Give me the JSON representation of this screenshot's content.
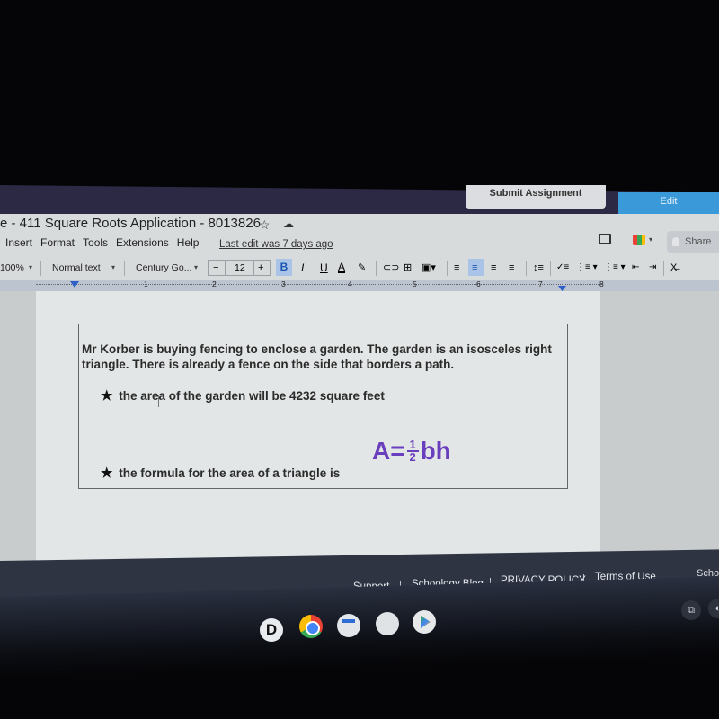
{
  "schoology": {
    "submit_label": "Submit Assignment",
    "edit_label": "Edit"
  },
  "doc": {
    "title": "e - 411 Square Roots Application - 8013826",
    "star_icon": "☆",
    "cloud_icon": "☁",
    "menu": [
      "Insert",
      "Format",
      "Tools",
      "Extensions",
      "Help"
    ],
    "last_edit": "Last edit was 7 days ago",
    "share_label": "Share"
  },
  "toolbar": {
    "zoom": "100%",
    "style": "Normal text",
    "font": "Century Go...",
    "font_size": "12",
    "minus": "−",
    "plus": "+",
    "bold": "B",
    "italic": "I",
    "underline": "U",
    "text_color": "A",
    "caret": "▾"
  },
  "ruler": {
    "numbers": [
      "1",
      "2",
      "3",
      "4",
      "5",
      "6",
      "7",
      "8"
    ]
  },
  "content": {
    "paragraph": "Mr Korber is buying fencing to enclose a garden.  The garden is an isosceles right triangle.  There is already a fence on the side that borders a path.",
    "bullet_star": "★",
    "bullet1": "the area of the garden will be 4232 square feet",
    "bullet2": "the formula for the area of a triangle is",
    "formula": {
      "lhs": "A=",
      "numerator": "1",
      "denominator": "2",
      "rhs": "bh"
    }
  },
  "footer": {
    "links": [
      "Support",
      "Schoology Blog",
      "PRIVACY POLICY",
      "Terms of Use"
    ],
    "separator": "|",
    "right_text": "Schoo"
  },
  "shelf": {
    "apps": [
      "Docs-D",
      "Chrome",
      "Google Docs",
      "Launcher",
      "Play Store"
    ],
    "d_label": "D"
  },
  "colors": {
    "accent_purple": "#6a3fbd",
    "edit_blue": "#3a9ad9",
    "highlight_blue": "#a9c4e6"
  }
}
